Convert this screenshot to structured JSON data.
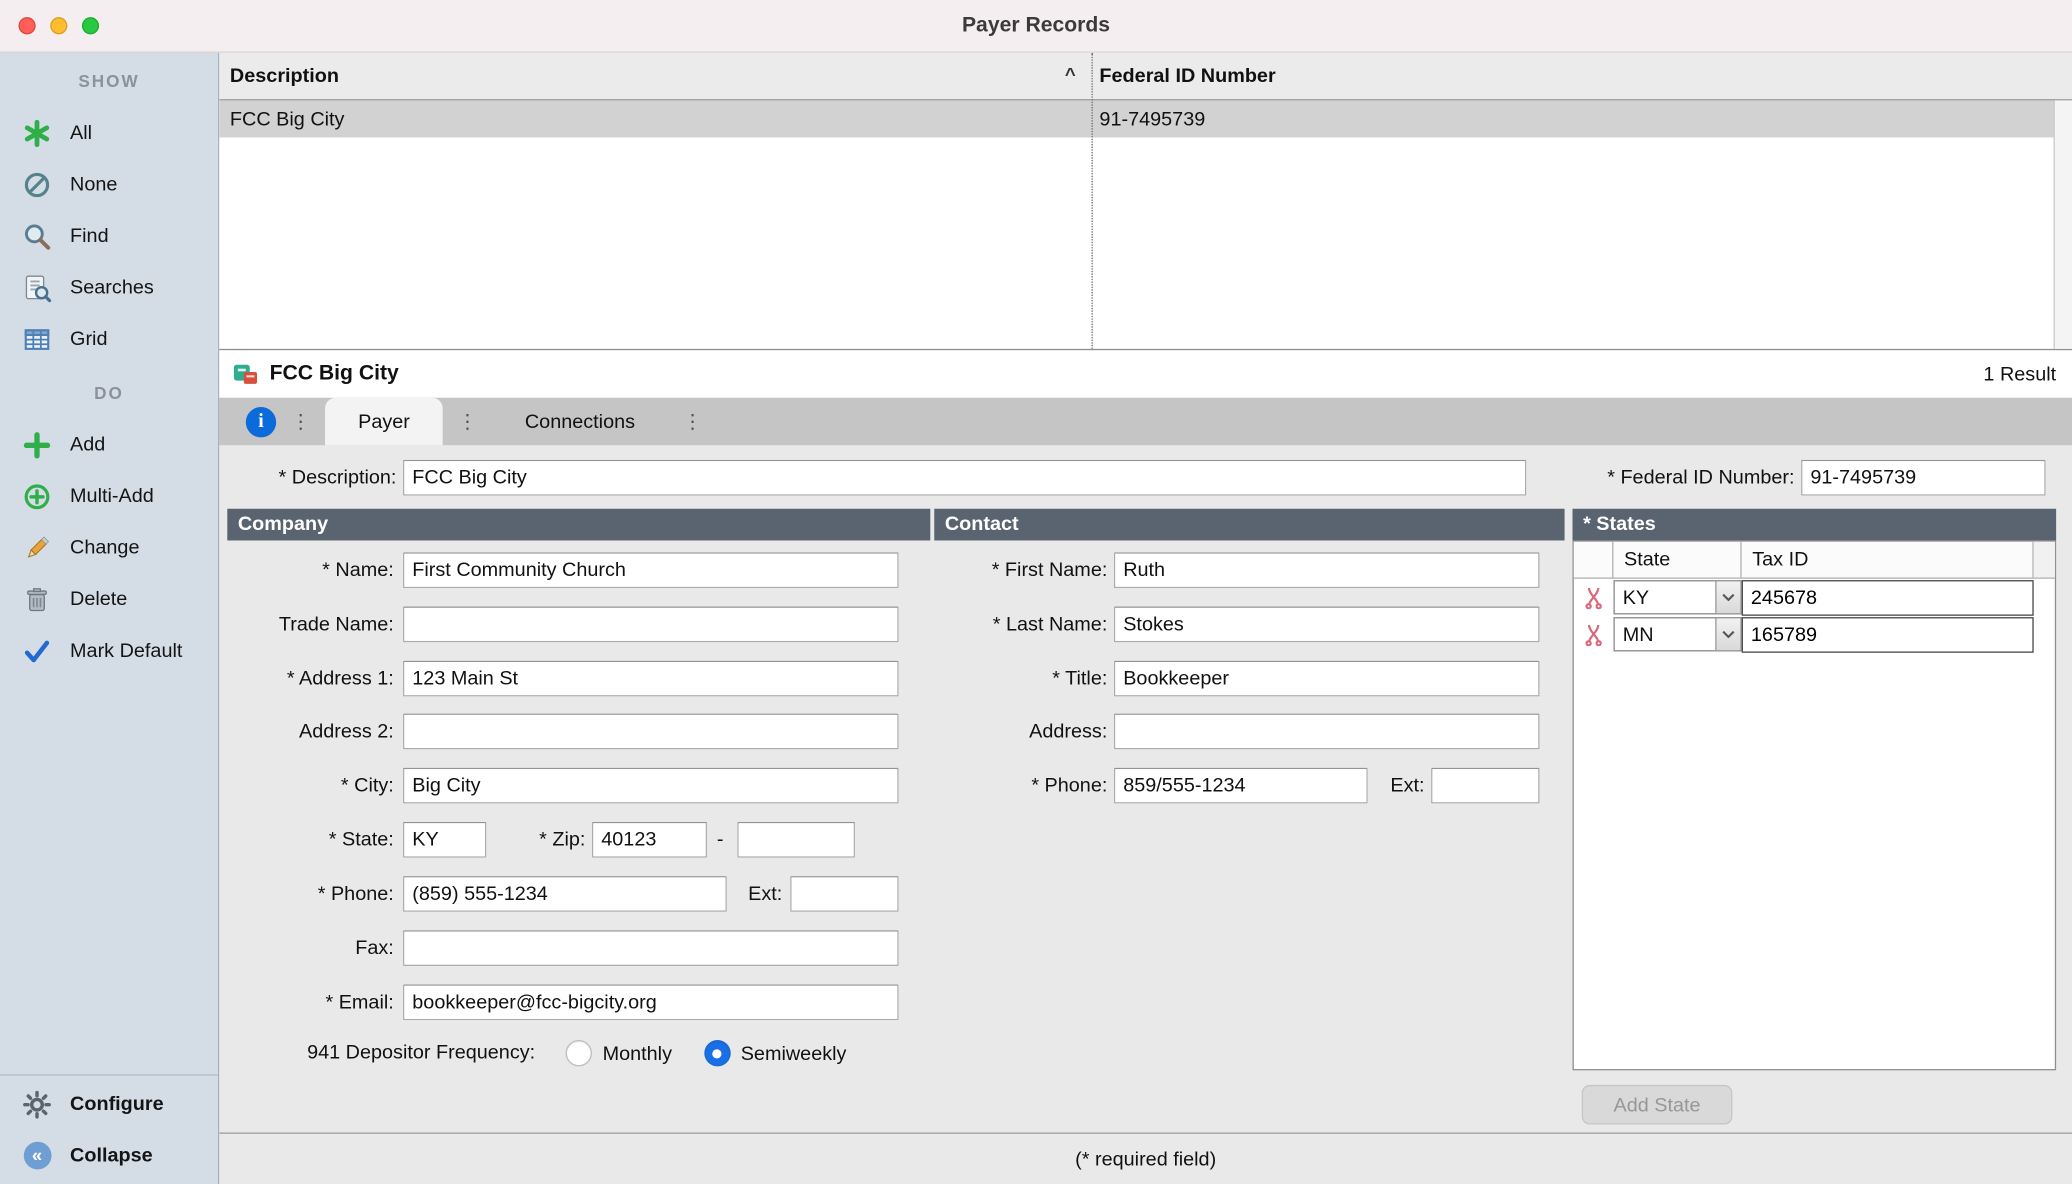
{
  "window": {
    "title": "Payer Records",
    "result_count": "1 Result",
    "required_note": "(* required field)"
  },
  "sidebar": {
    "show": {
      "header": "SHOW",
      "items": [
        {
          "label": "All"
        },
        {
          "label": "None"
        },
        {
          "label": "Find"
        },
        {
          "label": "Searches"
        },
        {
          "label": "Grid"
        }
      ]
    },
    "do": {
      "header": "DO",
      "items": [
        {
          "label": "Add"
        },
        {
          "label": "Multi-Add"
        },
        {
          "label": "Change"
        },
        {
          "label": "Delete"
        },
        {
          "label": "Mark Default"
        }
      ]
    },
    "footer": {
      "configure": "Configure",
      "collapse": "Collapse"
    }
  },
  "records_table": {
    "columns": {
      "description": "Description",
      "federal_id": "Federal ID Number"
    },
    "sort_indicator": "^",
    "rows": [
      {
        "description": "FCC Big City",
        "federal_id": "91-7495739"
      }
    ]
  },
  "record_header": {
    "title": "FCC Big City"
  },
  "tabs": {
    "info": "i",
    "menu_dots": "⋮",
    "payer": "Payer",
    "connections": "Connections"
  },
  "form": {
    "description": {
      "label": "* Description:",
      "value": "FCC Big City"
    },
    "federal_id": {
      "label": "* Federal ID Number:",
      "value": "91-7495739"
    },
    "company": {
      "header": "Company",
      "name": {
        "label": "* Name:",
        "value": "First Community Church"
      },
      "trade_name": {
        "label": "Trade Name:",
        "value": ""
      },
      "address1": {
        "label": "* Address 1:",
        "value": "123 Main St"
      },
      "address2": {
        "label": "Address 2:",
        "value": ""
      },
      "city": {
        "label": "* City:",
        "value": "Big City"
      },
      "state": {
        "label": "* State:",
        "value": "KY"
      },
      "zip": {
        "label": "* Zip:",
        "value": "40123"
      },
      "zip_separator": "-",
      "zip_plus4": {
        "value": ""
      },
      "phone": {
        "label": "* Phone:",
        "value": "(859) 555-1234"
      },
      "phone_ext": {
        "label": "Ext:",
        "value": ""
      },
      "fax": {
        "label": "Fax:",
        "value": ""
      },
      "email": {
        "label": "* Email:",
        "value": "bookkeeper@fcc-bigcity.org"
      },
      "frequency": {
        "label": "941 Depositor Frequency:",
        "options": [
          {
            "label": "Monthly",
            "selected": false
          },
          {
            "label": "Semiweekly",
            "selected": true
          }
        ]
      }
    },
    "contact": {
      "header": "Contact",
      "first_name": {
        "label": "* First Name:",
        "value": "Ruth"
      },
      "last_name": {
        "label": "* Last Name:",
        "value": "Stokes"
      },
      "title": {
        "label": "* Title:",
        "value": "Bookkeeper"
      },
      "address": {
        "label": "Address:",
        "value": ""
      },
      "phone": {
        "label": "* Phone:",
        "value": "859/555-1234"
      },
      "phone_ext": {
        "label": "Ext:",
        "value": ""
      }
    },
    "states": {
      "header": "* States",
      "columns": {
        "state": "State",
        "tax_id": "Tax ID"
      },
      "rows": [
        {
          "state": "KY",
          "tax_id": "245678"
        },
        {
          "state": "MN",
          "tax_id": "165789"
        }
      ],
      "add_button": "Add State"
    }
  }
}
